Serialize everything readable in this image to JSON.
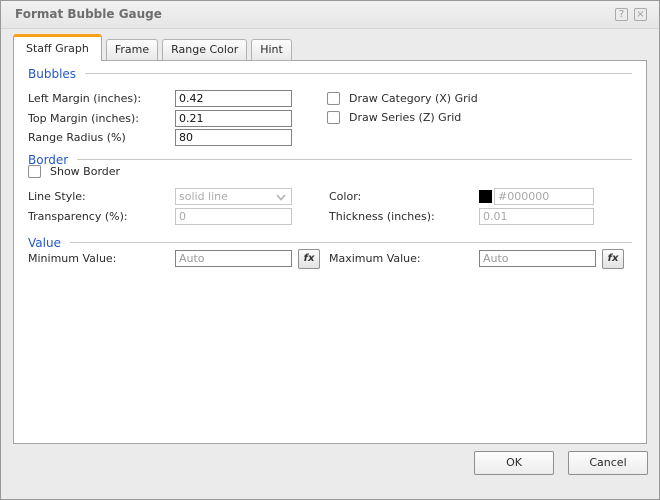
{
  "dialog": {
    "title": "Format Bubble Gauge",
    "help_glyph": "?",
    "close_glyph": "×"
  },
  "tabs": [
    {
      "label": "Staff Graph",
      "active": true
    },
    {
      "label": "Frame",
      "active": false
    },
    {
      "label": "Range Color",
      "active": false
    },
    {
      "label": "Hint",
      "active": false
    }
  ],
  "sections": {
    "bubbles": {
      "title": "Bubbles",
      "left_margin_label": "Left Margin (inches):",
      "left_margin_value": "0.42",
      "top_margin_label": "Top Margin (inches):",
      "top_margin_value": "0.21",
      "range_radius_label": "Range Radius (%)",
      "range_radius_value": "80",
      "draw_category_label": "Draw Category (X) Grid",
      "draw_category_checked": false,
      "draw_series_label": "Draw Series (Z) Grid",
      "draw_series_checked": false
    },
    "border": {
      "title": "Border",
      "show_border_label": "Show Border",
      "show_border_checked": false,
      "line_style_label": "Line Style:",
      "line_style_value": "solid line",
      "color_label": "Color:",
      "color_value": "#000000",
      "transparency_label": "Transparency (%):",
      "transparency_value": "0",
      "thickness_label": "Thickness (inches):",
      "thickness_value": "0.01"
    },
    "value": {
      "title": "Value",
      "minimum_label": "Minimum Value:",
      "minimum_value": "Auto",
      "maximum_label": "Maximum Value:",
      "maximum_value": "Auto",
      "fx_label": "fx"
    }
  },
  "footer": {
    "ok_label": "OK",
    "cancel_label": "Cancel"
  },
  "colors": {
    "tab_accent_orange": "#f7a11a",
    "section_header_blue": "#2456cb",
    "border_color_swatch": "#000000"
  }
}
